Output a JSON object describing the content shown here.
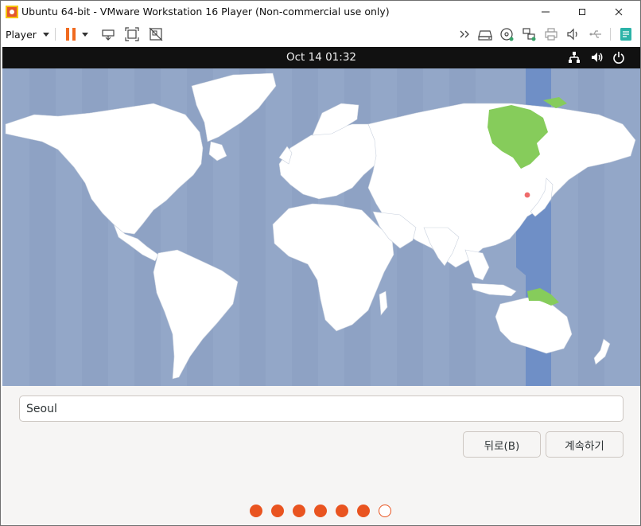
{
  "window": {
    "title": "Ubuntu 64-bit - VMware Workstation 16 Player (Non-commercial use only)"
  },
  "toolbar": {
    "player_label": "Player"
  },
  "guest": {
    "clock": "Oct 14  01:32"
  },
  "timezone": {
    "value": "Seoul"
  },
  "buttons": {
    "back": "뒤로(B)",
    "continue": "계속하기"
  },
  "progress": {
    "total": 7,
    "completed": 6
  },
  "colors": {
    "accent": "#e95420",
    "map_ocean": "#93a7c8",
    "map_land": "#ffffff",
    "tz_band": "#6f8fc6",
    "tz_highlight": "#86cc5b",
    "topbar": "#111111"
  }
}
